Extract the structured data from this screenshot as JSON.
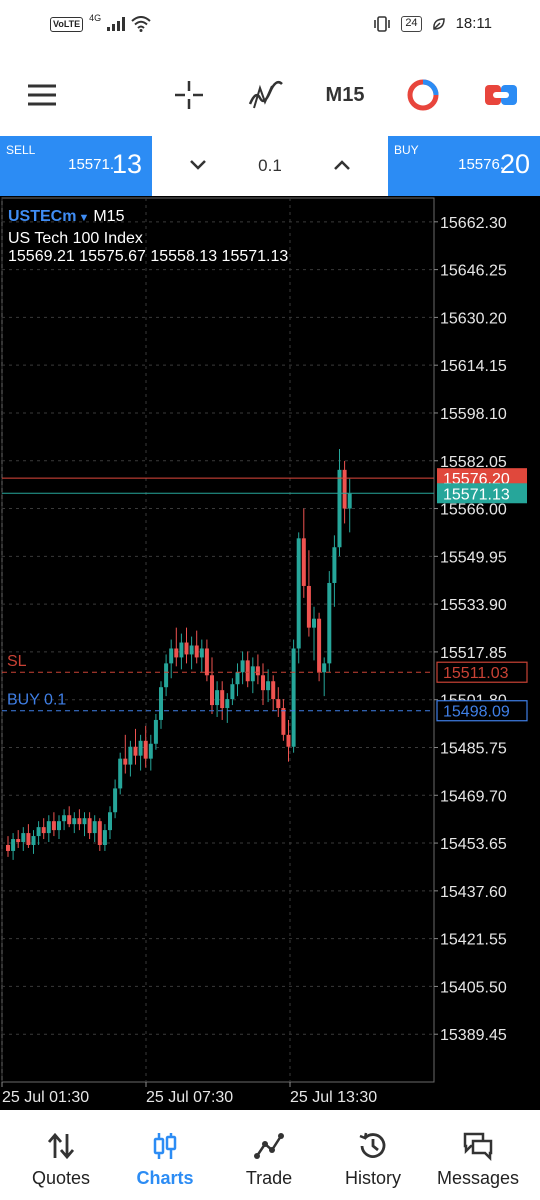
{
  "status_bar": {
    "volte": "VoLTE",
    "network": "4G",
    "battery": "24",
    "time": "18:11"
  },
  "toolbar": {
    "menu_icon": "hamburger-menu-icon",
    "crosshair_icon": "crosshair-icon",
    "indicators_icon": "indicators-icon",
    "timeframe": "M15",
    "logo_icon": "app-logo-icon",
    "oneclick_icon": "one-click-trading-icon"
  },
  "trade_bar": {
    "sell_label": "SELL",
    "sell_price_main": "15571.",
    "sell_price_big": "13",
    "lot": "0.1",
    "buy_label": "BUY",
    "buy_price_main": "15576.",
    "buy_price_big": "20",
    "accent": "#2c8cf4"
  },
  "chart_data": {
    "type": "candlestick",
    "symbol": "USTECm",
    "timeframe": "M15",
    "description": "US Tech 100 Index",
    "ohlc_text": "15569.21 15575.67 15558.13 15571.13",
    "price_ticks": [
      "15662.30",
      "15646.25",
      "15630.20",
      "15614.15",
      "15598.10",
      "15582.05",
      "15566.00",
      "15549.95",
      "15533.90",
      "15517.85",
      "15501.80",
      "15485.75",
      "15469.70",
      "15453.65",
      "15437.60",
      "15421.55",
      "15405.50",
      "15389.45"
    ],
    "time_ticks": [
      "25 Jul 01:30",
      "25 Jul 07:30",
      "25 Jul 13:30"
    ],
    "ylim": [
      15373.4,
      15670.3
    ],
    "grid": true,
    "levels": [
      {
        "label": "",
        "price": 15576.2,
        "tag": "15576.20",
        "color": "#e0483c"
      },
      {
        "label": "",
        "price": 15571.13,
        "tag": "15571.13",
        "color": "#26a69a"
      },
      {
        "label": "SL",
        "price": 15511.03,
        "tag": "15511.03",
        "color": "#c94235"
      },
      {
        "label": "BUY 0.1",
        "price": 15498.09,
        "tag": "15498.09",
        "color": "#3f7fe6"
      }
    ],
    "candles": [
      [
        15453,
        15456,
        15449,
        15451
      ],
      [
        15451,
        15457,
        15448,
        15455
      ],
      [
        15455,
        15458,
        15452,
        15454
      ],
      [
        15454,
        15459,
        15451,
        15457
      ],
      [
        15457,
        15460,
        15452,
        15453
      ],
      [
        15453,
        15458,
        15450,
        15456
      ],
      [
        15456,
        15461,
        15453,
        15459
      ],
      [
        15459,
        15462,
        15455,
        15457
      ],
      [
        15457,
        15463,
        15454,
        15461
      ],
      [
        15461,
        15464,
        15456,
        15458
      ],
      [
        15458,
        15463,
        15455,
        15461
      ],
      [
        15461,
        15465,
        15458,
        15463
      ],
      [
        15463,
        15466,
        15459,
        15460
      ],
      [
        15460,
        15464,
        15457,
        15462
      ],
      [
        15462,
        15465,
        15458,
        15460
      ],
      [
        15460,
        15464,
        15456,
        15462
      ],
      [
        15462,
        15464,
        15455,
        15457
      ],
      [
        15457,
        15463,
        15454,
        15461
      ],
      [
        15461,
        15462,
        15451,
        15453
      ],
      [
        15453,
        15460,
        15451,
        15458
      ],
      [
        15458,
        15466,
        15455,
        15464
      ],
      [
        15464,
        15475,
        15462,
        15472
      ],
      [
        15472,
        15484,
        15470,
        15482
      ],
      [
        15482,
        15490,
        15477,
        15480
      ],
      [
        15480,
        15488,
        15476,
        15486
      ],
      [
        15486,
        15492,
        15480,
        15483
      ],
      [
        15483,
        15490,
        15478,
        15488
      ],
      [
        15488,
        15493,
        15479,
        15482
      ],
      [
        15482,
        15490,
        15478,
        15487
      ],
      [
        15487,
        15497,
        15485,
        15495
      ],
      [
        15495,
        15508,
        15492,
        15506
      ],
      [
        15506,
        15517,
        15503,
        15514
      ],
      [
        15514,
        15522,
        15509,
        15519
      ],
      [
        15519,
        15526,
        15513,
        15516
      ],
      [
        15516,
        15524,
        15512,
        15521
      ],
      [
        15521,
        15526,
        15514,
        15517
      ],
      [
        15517,
        15523,
        15512,
        15520
      ],
      [
        15520,
        15525,
        15514,
        15516
      ],
      [
        15516,
        15522,
        15511,
        15519
      ],
      [
        15519,
        15522,
        15508,
        15510
      ],
      [
        15510,
        15516,
        15497,
        15500
      ],
      [
        15500,
        15508,
        15496,
        15505
      ],
      [
        15505,
        15508,
        15495,
        15499
      ],
      [
        15499,
        15504,
        15494,
        15502
      ],
      [
        15502,
        15509,
        15500,
        15507
      ],
      [
        15507,
        15514,
        15503,
        15511
      ],
      [
        15511,
        15518,
        15507,
        15515
      ],
      [
        15515,
        15518,
        15506,
        15508
      ],
      [
        15508,
        15516,
        15504,
        15513
      ],
      [
        15513,
        15517,
        15507,
        15510
      ],
      [
        15510,
        15514,
        15500,
        15505
      ],
      [
        15505,
        15512,
        15501,
        15508
      ],
      [
        15508,
        15510,
        15498,
        15502
      ],
      [
        15502,
        15506,
        15496,
        15499
      ],
      [
        15499,
        15502,
        15488,
        15490
      ],
      [
        15490,
        15495,
        15481,
        15486
      ],
      [
        15486,
        15522,
        15484,
        15519
      ],
      [
        15519,
        15558,
        15514,
        15556
      ],
      [
        15556,
        15566,
        15536,
        15540
      ],
      [
        15540,
        15552,
        15523,
        15526
      ],
      [
        15526,
        15533,
        15515,
        15529
      ],
      [
        15529,
        15531,
        15508,
        15511
      ],
      [
        15511,
        15516,
        15503,
        15514
      ],
      [
        15514,
        15545,
        15511,
        15541
      ],
      [
        15541,
        15557,
        15533,
        15553
      ],
      [
        15553,
        15586,
        15550,
        15579
      ],
      [
        15579,
        15582,
        15561,
        15566
      ],
      [
        15566,
        15576,
        15558,
        15571
      ]
    ]
  },
  "bottom_nav": [
    {
      "label": "Quotes",
      "icon": "quotes-arrows-icon",
      "active": false
    },
    {
      "label": "Charts",
      "icon": "charts-candles-icon",
      "active": true
    },
    {
      "label": "Trade",
      "icon": "trade-line-icon",
      "active": false
    },
    {
      "label": "History",
      "icon": "history-clock-icon",
      "active": false
    },
    {
      "label": "Messages",
      "icon": "messages-icon",
      "active": false
    }
  ]
}
